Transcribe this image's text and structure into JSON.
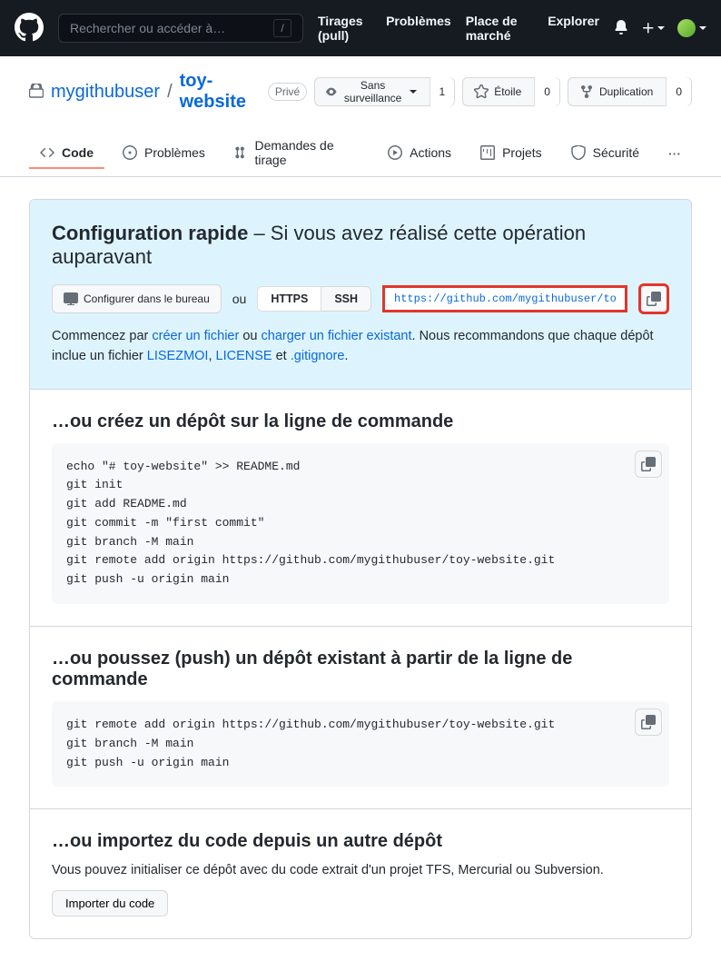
{
  "header": {
    "search_placeholder": "Rechercher ou accéder à…",
    "slash": "/",
    "nav": {
      "pulls": "Tirages (pull)",
      "issues": "Problèmes",
      "market": "Place de marché",
      "explore": "Explorer"
    }
  },
  "repo": {
    "owner": "mygithubuser",
    "name": "toy-website",
    "visibility": "Privé",
    "actions": {
      "watch": "Sans surveillance",
      "watch_count": "1",
      "star": "Étoile",
      "star_count": "0",
      "fork": "Duplication",
      "fork_count": "0"
    },
    "tabs": {
      "code": "Code",
      "issues": "Problèmes",
      "pulls": "Demandes de tirage",
      "actions": "Actions",
      "projects": "Projets",
      "security": "Sécurité"
    }
  },
  "quicksetup": {
    "title_prefix": "Configuration rapide",
    "title_rest": " – Si vous avez réalisé cette opération auparavant",
    "desktop_btn": "Configurer dans le bureau",
    "or": "ou",
    "https": "HTTPS",
    "ssh": "SSH",
    "url": "https://github.com/mygithubuser/toy-website.git",
    "help_start": "Commencez par ",
    "link_create": "créer un fichier",
    "help_or": " ou ",
    "link_upload": "charger un fichier existant",
    "help_rec": ". Nous recommandons que chaque dépôt inclue un fichier ",
    "link_readme": "LISEZMOI",
    "comma": ", ",
    "link_license": "LICENSE",
    "and": " et ",
    "link_gitignore": ".gitignore",
    "period": "."
  },
  "create_section": {
    "title": "…ou créez un dépôt sur la ligne de commande",
    "code": "echo \"# toy-website\" >> README.md\ngit init\ngit add README.md\ngit commit -m \"first commit\"\ngit branch -M main\ngit remote add origin https://github.com/mygithubuser/toy-website.git\ngit push -u origin main"
  },
  "push_section": {
    "title": "…ou poussez (push) un dépôt existant à partir de la ligne de commande",
    "code": "git remote add origin https://github.com/mygithubuser/toy-website.git\ngit branch -M main\ngit push -u origin main"
  },
  "import_section": {
    "title": "…ou importez du code depuis un autre dépôt",
    "desc": "Vous pouvez initialiser ce dépôt avec du code extrait d'un projet TFS, Mercurial ou Subversion.",
    "btn": "Importer du code"
  }
}
